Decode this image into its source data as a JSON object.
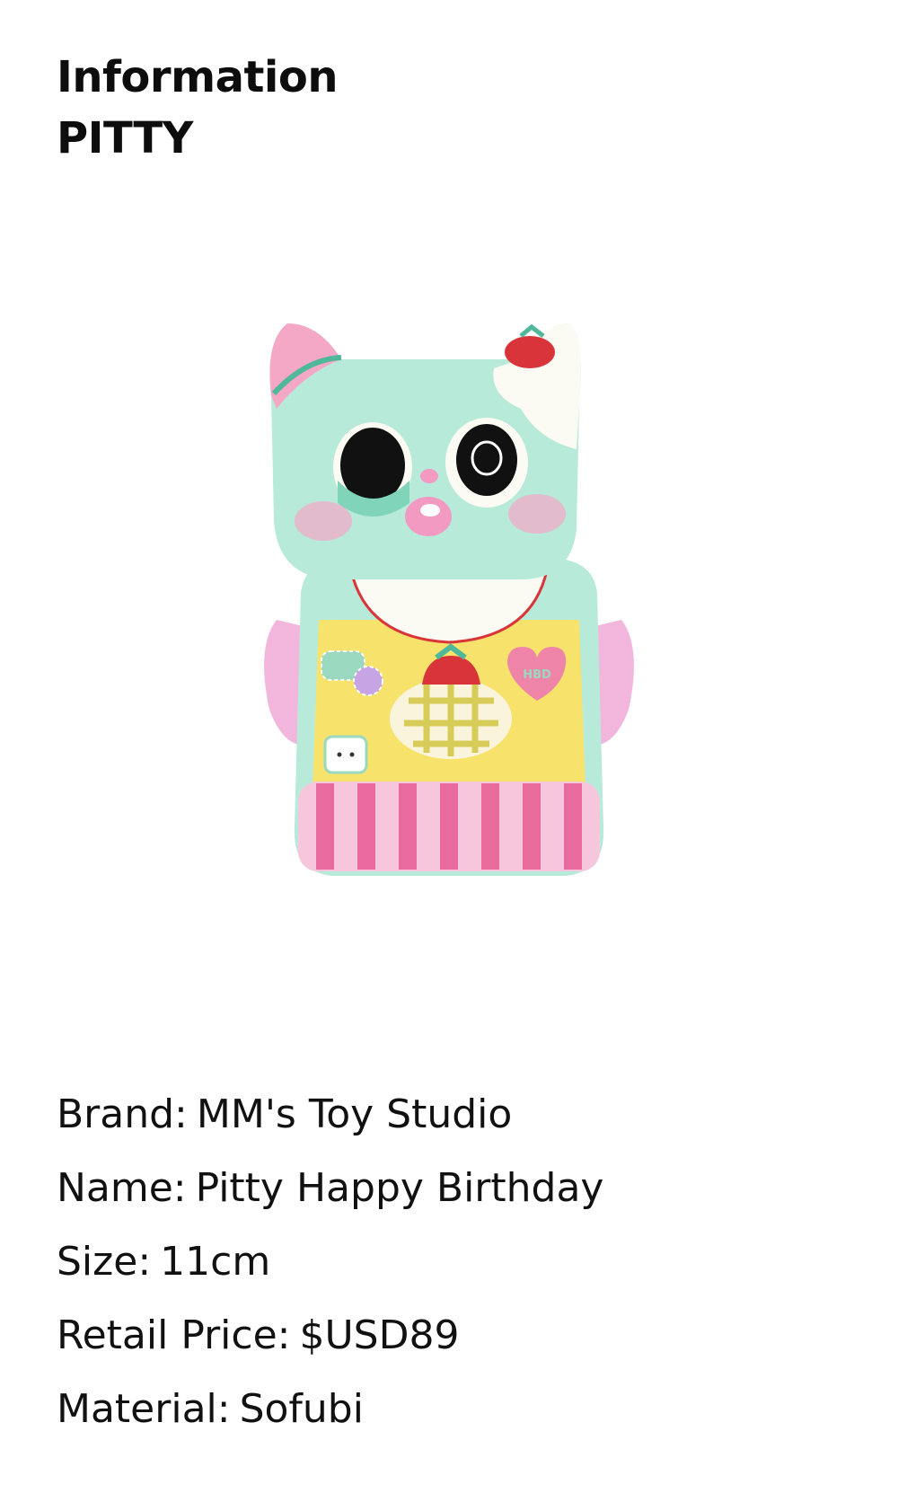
{
  "header": {
    "title": "Information",
    "subtitle": "PITTY"
  },
  "product_image": {
    "icon": "pitty-figure-illustration",
    "colors": {
      "mint": "#b8ead9",
      "pink": "#f4a8c6",
      "yellow": "#f7e36b",
      "stripe_pink": "#e96a9d",
      "strawberry": "#d9343a"
    },
    "badge_text": "HBD"
  },
  "details": [
    {
      "label": "Brand:",
      "value": "MM's Toy Studio"
    },
    {
      "label": "Name:",
      "value": "Pitty Happy Birthday"
    },
    {
      "label": "Size:",
      "value": "11cm"
    },
    {
      "label": "Retail Price:",
      "value": "$USD89"
    },
    {
      "label": "Material:",
      "value": "Sofubi"
    }
  ]
}
